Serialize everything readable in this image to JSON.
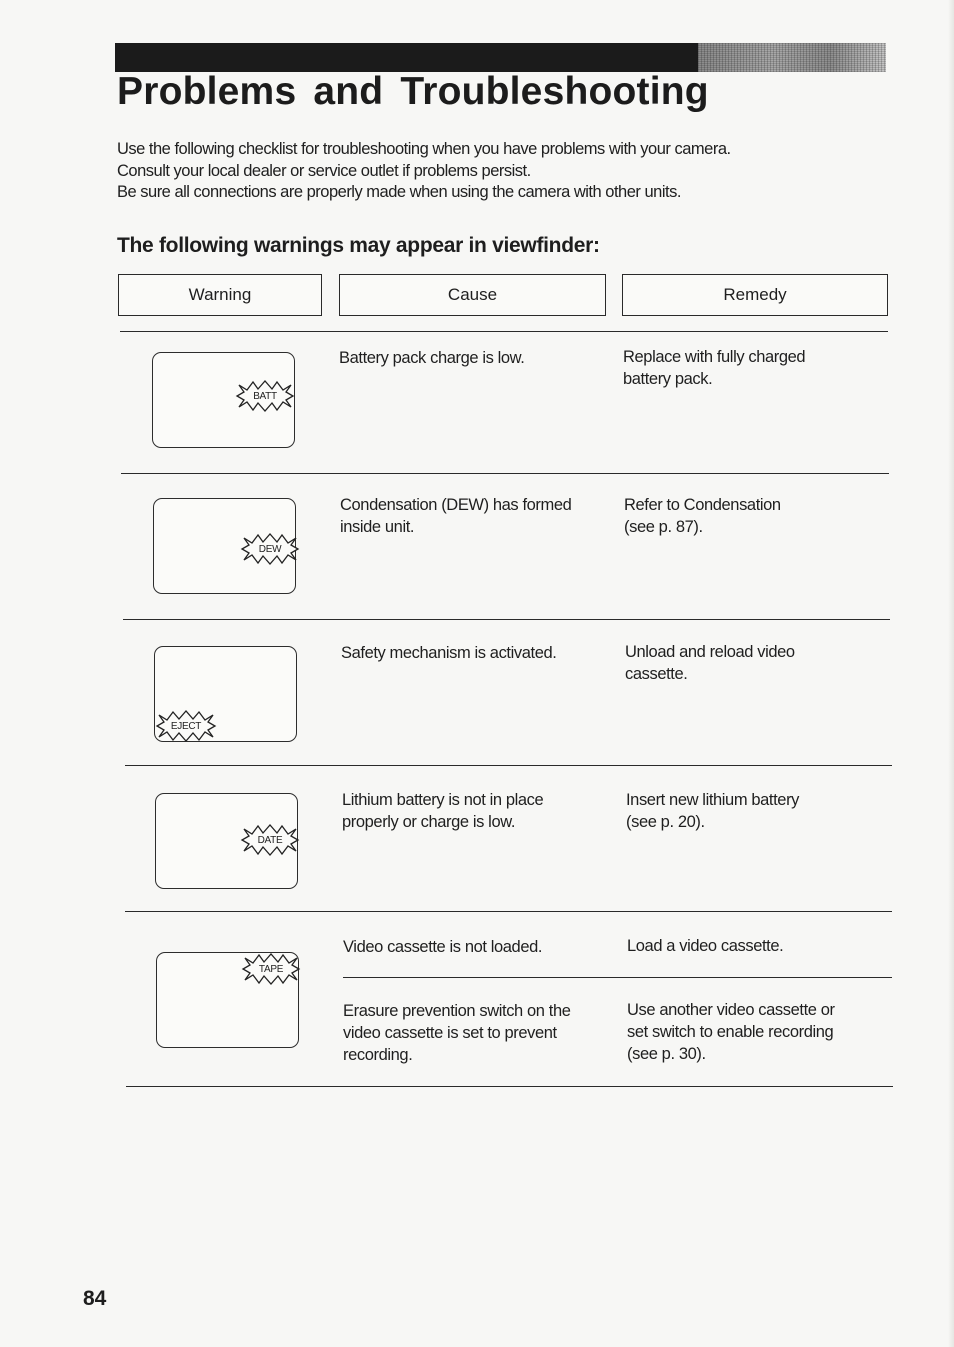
{
  "page": {
    "title": "Problems and Troubleshooting",
    "intro_lines": [
      "Use the following checklist for troubleshooting when you have problems with your camera.",
      "Consult your local dealer or service outlet if problems persist.",
      "Be sure all connections are properly made when using the camera with other units."
    ],
    "subheading": "The following warnings may appear in viewfinder:",
    "page_number": "84"
  },
  "table": {
    "headers": {
      "warning": "Warning",
      "cause": "Cause",
      "remedy": "Remedy"
    },
    "rows": [
      {
        "indicator": "BATT",
        "entries": [
          {
            "cause": [
              "Battery pack charge is low."
            ],
            "remedy": [
              "Replace with fully charged",
              "battery pack."
            ]
          }
        ]
      },
      {
        "indicator": "DEW",
        "entries": [
          {
            "cause": [
              "Condensation (DEW) has formed",
              "inside unit."
            ],
            "remedy": [
              "Refer to Condensation",
              "(see p. 87)."
            ]
          }
        ]
      },
      {
        "indicator": "EJECT",
        "entries": [
          {
            "cause": [
              "Safety mechanism is activated."
            ],
            "remedy": [
              "Unload and reload video",
              "cassette."
            ]
          }
        ]
      },
      {
        "indicator": "DATE",
        "entries": [
          {
            "cause": [
              "Lithium battery is not in place",
              "properly or charge is low."
            ],
            "remedy": [
              "Insert new lithium battery",
              "(see p. 20)."
            ]
          }
        ]
      },
      {
        "indicator": "TAPE",
        "entries": [
          {
            "cause": [
              "Video cassette is not loaded."
            ],
            "remedy": [
              "Load a video cassette."
            ]
          },
          {
            "cause": [
              "Erasure prevention switch on the",
              "video cassette is set to prevent",
              "recording."
            ],
            "remedy": [
              "Use another video cassette or",
              "set switch to enable recording",
              "(see p. 30)."
            ]
          }
        ]
      }
    ]
  }
}
